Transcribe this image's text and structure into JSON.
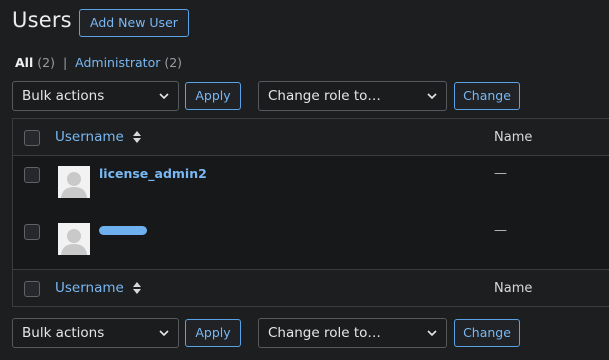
{
  "header": {
    "title": "Users",
    "add_new_label": "Add New User"
  },
  "filters": {
    "all_label": "All",
    "all_count": "(2)",
    "separator": "|",
    "administrator_label": "Administrator",
    "administrator_count": "(2)"
  },
  "top_nav": {
    "bulk_actions_value": "Bulk actions",
    "apply_label": "Apply",
    "change_role_value": "Change role to…",
    "change_label": "Change"
  },
  "bottom_nav": {
    "bulk_actions_value": "Bulk actions",
    "apply_label": "Apply",
    "change_role_value": "Change role to…",
    "change_label": "Change"
  },
  "table": {
    "columns": [
      "Username",
      "Name"
    ],
    "rows": [
      {
        "username": "license_admin2",
        "name": "—"
      },
      {
        "username": "",
        "name": "—"
      }
    ],
    "footer_columns": [
      "Username",
      "Name"
    ]
  },
  "colors": {
    "background": "#1d1e20",
    "link": "#79b8f3",
    "border": "#3a3c40"
  }
}
